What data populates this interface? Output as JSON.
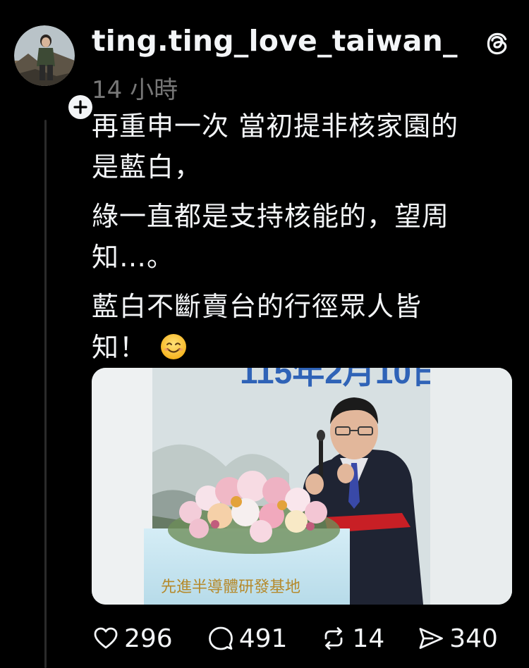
{
  "author": {
    "username": "ting.ting_love_taiwan_",
    "timestamp": "14 小時",
    "avatar_icon": "profile-photo",
    "follow_icon": "plus-icon"
  },
  "post": {
    "paragraphs": [
      [
        "再重申一次 當初提非核家園的",
        "是藍白，"
      ],
      [
        "綠一直都是支持核能的，望周",
        "知…。"
      ],
      [
        "藍白不斷賣台的行徑眾人皆",
        "知！"
      ]
    ],
    "emoji": "smiling-face-emoji",
    "image": {
      "banner_text": "115年2月10日",
      "podium_text": "先進半導體研發基地"
    }
  },
  "actions": {
    "likes": "296",
    "replies": "491",
    "reposts": "14",
    "shares": "340"
  },
  "colors": {
    "background": "#000000",
    "text": "#f3f5f7",
    "muted": "#777777"
  }
}
